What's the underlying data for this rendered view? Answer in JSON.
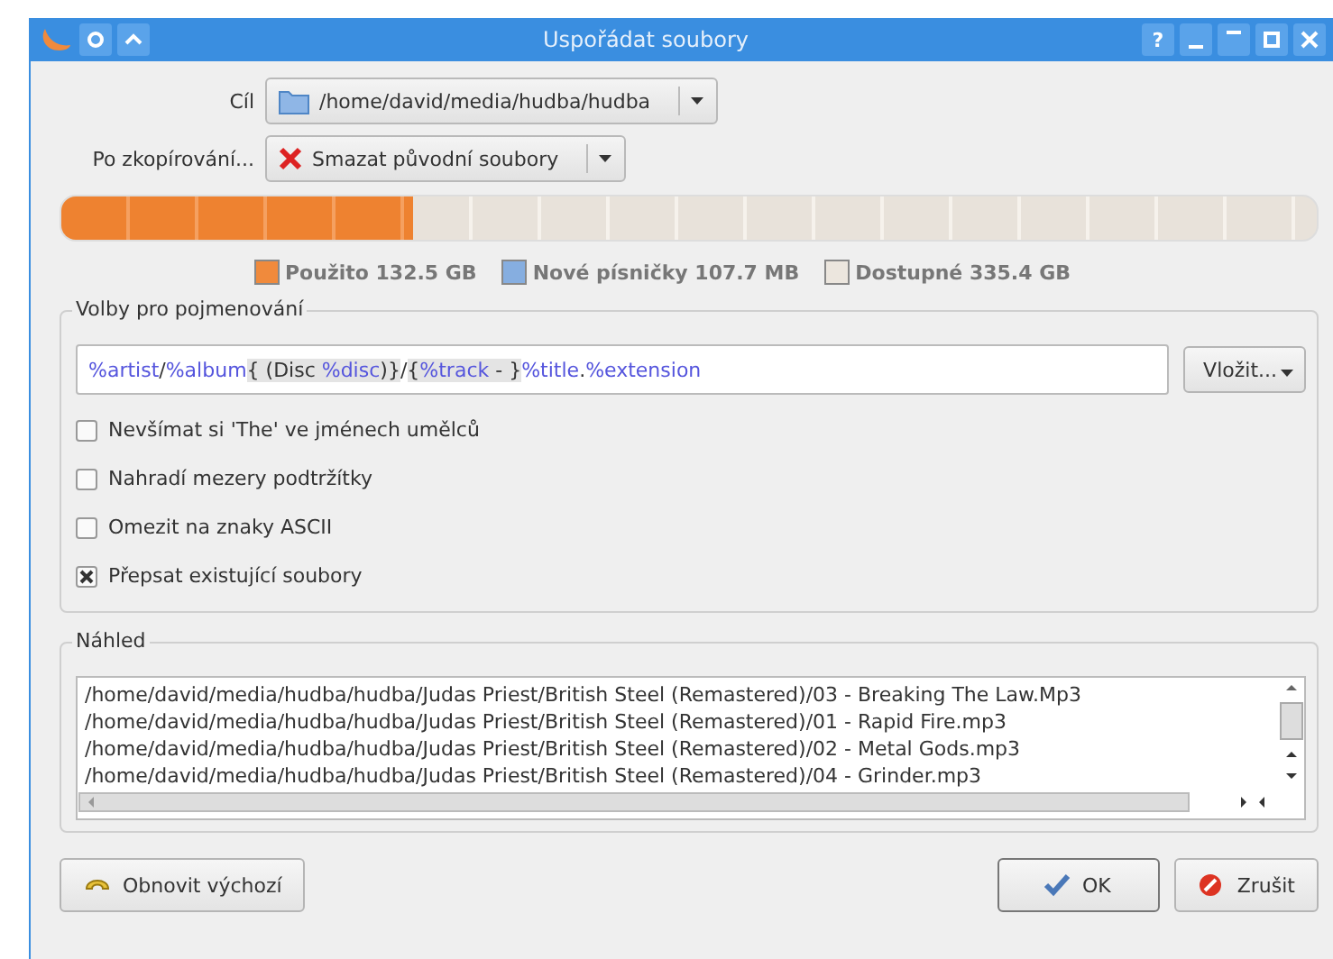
{
  "window": {
    "title": "Uspořádat soubory",
    "help_button": "?"
  },
  "destination": {
    "label": "Cíl",
    "value": "/home/david/media/hudba/hudba"
  },
  "after_copy": {
    "label": "Po zkopírování...",
    "value": "Smazat původní soubory"
  },
  "capacity": {
    "level": 0.28,
    "legend": [
      {
        "label": "Použito 132.5 GB",
        "color": "#f08a3c"
      },
      {
        "label": "Nové písničky 107.7 MB",
        "color": "#86aee0"
      },
      {
        "label": "Dostupné 335.4 GB",
        "color": "#ece6de"
      }
    ]
  },
  "naming": {
    "title": "Volby pro pojmenování",
    "scheme": [
      {
        "text": "%artist",
        "kind": "tag"
      },
      {
        "text": "/",
        "kind": "literal"
      },
      {
        "text": "%album",
        "kind": "tag"
      },
      {
        "text": "{ (Disc ",
        "kind": "optional_literal"
      },
      {
        "text": "%disc",
        "kind": "optional_tag"
      },
      {
        "text": ")}",
        "kind": "optional_literal"
      },
      {
        "text": "/",
        "kind": "literal"
      },
      {
        "text": "{",
        "kind": "optional_literal"
      },
      {
        "text": "%track",
        "kind": "optional_tag"
      },
      {
        "text": " - }",
        "kind": "optional_literal"
      },
      {
        "text": "%title",
        "kind": "tag"
      },
      {
        "text": ".",
        "kind": "literal"
      },
      {
        "text": "%extension",
        "kind": "tag"
      }
    ],
    "insert_button": "Vložit...",
    "options": [
      {
        "label": "Nevšímat si 'The' ve jménech umělců",
        "checked": false
      },
      {
        "label": "Nahradí mezery podtržítky",
        "checked": false
      },
      {
        "label": "Omezit na znaky ASCII",
        "checked": false
      },
      {
        "label": "Přepsat existující soubory",
        "checked": true
      }
    ]
  },
  "preview": {
    "title": "Náhled",
    "rows": [
      "/home/david/media/hudba/hudba/Judas Priest/British Steel (Remastered)/03 - Breaking The Law.Mp3",
      "/home/david/media/hudba/hudba/Judas Priest/British Steel (Remastered)/01 - Rapid Fire.mp3",
      "/home/david/media/hudba/hudba/Judas Priest/British Steel (Remastered)/02 - Metal Gods.mp3",
      "/home/david/media/hudba/hudba/Judas Priest/British Steel (Remastered)/04 - Grinder.mp3"
    ]
  },
  "buttons": {
    "reset": "Obnovit výchozí",
    "ok": "OK",
    "cancel": "Zrušit"
  }
}
